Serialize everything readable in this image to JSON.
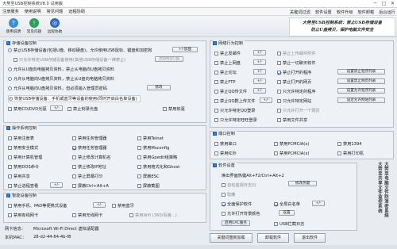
{
  "window": {
    "title": "大势至USB控制系统V8.0 试用版",
    "min": "─",
    "max": "□",
    "close": "✕"
  },
  "menu": {
    "left": [
      "注册服务",
      "使用说明",
      "常见问题",
      "远程协助"
    ],
    "right": [
      "关键词过滤",
      "软件设置",
      "软件升级",
      "软件卸载",
      "后台运行"
    ]
  },
  "toolbar": [
    {
      "label": "使用说明",
      "icon": "help-icon",
      "color": "#3a8fd8"
    },
    {
      "label": "常见问题",
      "icon": "question-icon",
      "color": "#2e9e5b"
    },
    {
      "label": "远程协助",
      "icon": "remote-assist-icon",
      "color": "#3067c9"
    }
  ],
  "banner": {
    "line1": "大势至USB控制系统：禁止USB存储设备",
    "line2": "防止U盘拷贝，保护电脑文件安全"
  },
  "storage": {
    "title": "存储设备控制",
    "items": [
      {
        "type": "radio",
        "checked": false,
        "label": "禁止USB存储设备(包括U盘、移动硬盘)，允许使用USB鼠标、键盘和加密狗"
      },
      {
        "type": "check",
        "checked": false,
        "label": "只允许特定USB存储设备使用(其他USB存储设备一律禁止)",
        "muted": true
      },
      {
        "type": "radio",
        "checked": false,
        "label": "允许从U盘向电脑拷贝资料，禁止从电脑向U盘拷贝资料"
      },
      {
        "type": "radio",
        "checked": false,
        "label": "允许从电脑向U盘拷贝资料，禁止从U盘向电脑拷贝资料"
      },
      {
        "type": "radio",
        "checked": false,
        "label": "允许从电脑向U盘拷贝资料，但必须输入管理员密码"
      },
      {
        "type": "radio",
        "checked": true,
        "label": "恢复USB存储设备、手机或蓝牙等设备的使用(同时开启白名单设备)"
      },
      {
        "type": "check",
        "checked": false,
        "label": "禁用CD/DVD光驱"
      },
      {
        "type": "check",
        "checked": false,
        "label": "禁止刻录光盘"
      },
      {
        "type": "check",
        "checked": false,
        "label": "禁用软驱"
      }
    ],
    "buttons": {
      "add": "+/-加盘",
      "whitelist": "添加特定U盘",
      "modify": "修改"
    }
  },
  "os": {
    "title": "操作系统控制",
    "items": [
      {
        "checked": false,
        "label": "禁用注册表"
      },
      {
        "checked": false,
        "label": "禁用任务管理器"
      },
      {
        "checked": false,
        "label": "禁用Telnet"
      },
      {
        "checked": false,
        "label": "禁用安全模式"
      },
      {
        "checked": true,
        "label": "禁用任务管理器"
      },
      {
        "checked": false,
        "label": "禁用Msconfig"
      },
      {
        "checked": false,
        "label": "禁用计算机管理"
      },
      {
        "checked": false,
        "label": "禁止修改计算机名"
      },
      {
        "checked": false,
        "label": "禁用Gpedit组策略"
      },
      {
        "checked": false,
        "label": "禁用DOS命令"
      },
      {
        "checked": false,
        "label": "禁止修改IP地址"
      },
      {
        "checked": false,
        "label": "禁用格式化和Ghost"
      },
      {
        "checked": false,
        "label": "禁用共享"
      },
      {
        "checked": false,
        "label": "禁止屏幕打印"
      },
      {
        "checked": false,
        "label": "屏蔽ESC"
      },
      {
        "checked": false,
        "label": "禁止进程查看"
      },
      {
        "checked": false,
        "label": "屏蔽Ctrl+Alt+A"
      },
      {
        "checked": false,
        "label": "屏蔽截图"
      }
    ],
    "buttons": {
      "process": "+/-",
      "ctrl": "+/-"
    }
  },
  "smart": {
    "title": "智能设备控制",
    "items": [
      {
        "checked": false,
        "label": "禁用手机、PAD等便携式设备"
      },
      {
        "checked": false,
        "label": "禁用蓝牙"
      },
      {
        "checked": false,
        "label": "禁用有线网卡"
      },
      {
        "checked": false,
        "label": "禁用无线网卡"
      },
      {
        "checked": false,
        "label": "禁用Wifi (360/百度...)",
        "muted": true
      }
    ],
    "buttons": {
      "phone": "+/-",
      "wifi": "+/-"
    }
  },
  "info": {
    "name_key": "网卡信息：",
    "name_val": "Microsoft Wi-Fi Direct 虚拟适配器",
    "mac_key": "本机MAC：",
    "mac_val": "28-d2-44-84-4b-f8"
  },
  "network": {
    "title": "网络行为控制",
    "items": [
      {
        "checked": false,
        "label": "禁止发邮件"
      },
      {
        "checked": false,
        "label": "禁止上传邮件附件",
        "muted": true
      },
      {
        "checked": false,
        "label": "禁止上网盘"
      },
      {
        "checked": false,
        "label": "禁止一切聊天软件"
      },
      {
        "checked": false,
        "label": "禁止论坛"
      },
      {
        "checked": true,
        "label": "禁止打开的程序"
      },
      {
        "checked": false,
        "label": "禁止FTP"
      },
      {
        "checked": false,
        "label": "禁止打开的网页"
      },
      {
        "checked": false,
        "label": "禁止QQ传文件"
      },
      {
        "checked": false,
        "label": "只允许特定的程序"
      },
      {
        "checked": false,
        "label": "禁止QQ群上传文件"
      },
      {
        "checked": false,
        "label": "只允许特定网站"
      },
      {
        "checked": false,
        "label": "只允许特定QQ登录"
      },
      {
        "checked": false,
        "label": "只允许打开一个网页",
        "muted": true
      },
      {
        "checked": false,
        "label": "只允许特定旺旺登录"
      },
      {
        "checked": false,
        "label": "禁用文件共享"
      }
    ],
    "buttons": {
      "mail": "+/-",
      "disk": "+/-",
      "forum": "+/-",
      "ftp": "+/-",
      "qq": "+/-",
      "group": "+/-",
      "set_program": "设置禁止程序列表",
      "set_web": "设置禁止网页列表",
      "set_allow_program": "设置允许程序列表",
      "set_allow_site": "设定允许网站列表"
    }
  },
  "port": {
    "title": "端口控制",
    "items": [
      {
        "checked": false,
        "label": "禁用串口"
      },
      {
        "checked": false,
        "label": "禁用PCMCIA(x)"
      },
      {
        "checked": false,
        "label": "禁用1394"
      },
      {
        "checked": false,
        "label": "禁用红外"
      },
      {
        "checked": false,
        "label": "禁用PCMCIA(x)"
      },
      {
        "checked": false,
        "label": "禁用打印机"
      }
    ]
  },
  "software": {
    "title": "软件设置",
    "hotkey_label": "唤出界面热键Alt+F2/Ctrl+Alt+2",
    "modify_hotkey": "修改热键",
    "items": [
      {
        "checked": false,
        "label": "自动监视日志(I)",
        "muted": true
      },
      {
        "checked": false,
        "label": "隐藏",
        "muted": true
      },
      {
        "checked": true,
        "label": "全面保护软件"
      },
      {
        "checked": true,
        "label": "全局白名单"
      },
      {
        "checked": false,
        "label": "允许打开背景颜色"
      },
      {
        "checked": false,
        "label": "启用UAC服务"
      },
      {
        "checked": false,
        "label": "USB拦截日志"
      }
    ],
    "buttons": {
      "whitelist": "+/-",
      "color": "设置",
      "uac": "启用UAC服务"
    }
  },
  "seal": {
    "text1": "大势至电脑文件防泄密系统",
    "text2": "大势至共享文件监控系统"
  },
  "bottom": {
    "keyword": "关键词重新加载",
    "unload": "卸载软件",
    "exit": "退出软件"
  }
}
